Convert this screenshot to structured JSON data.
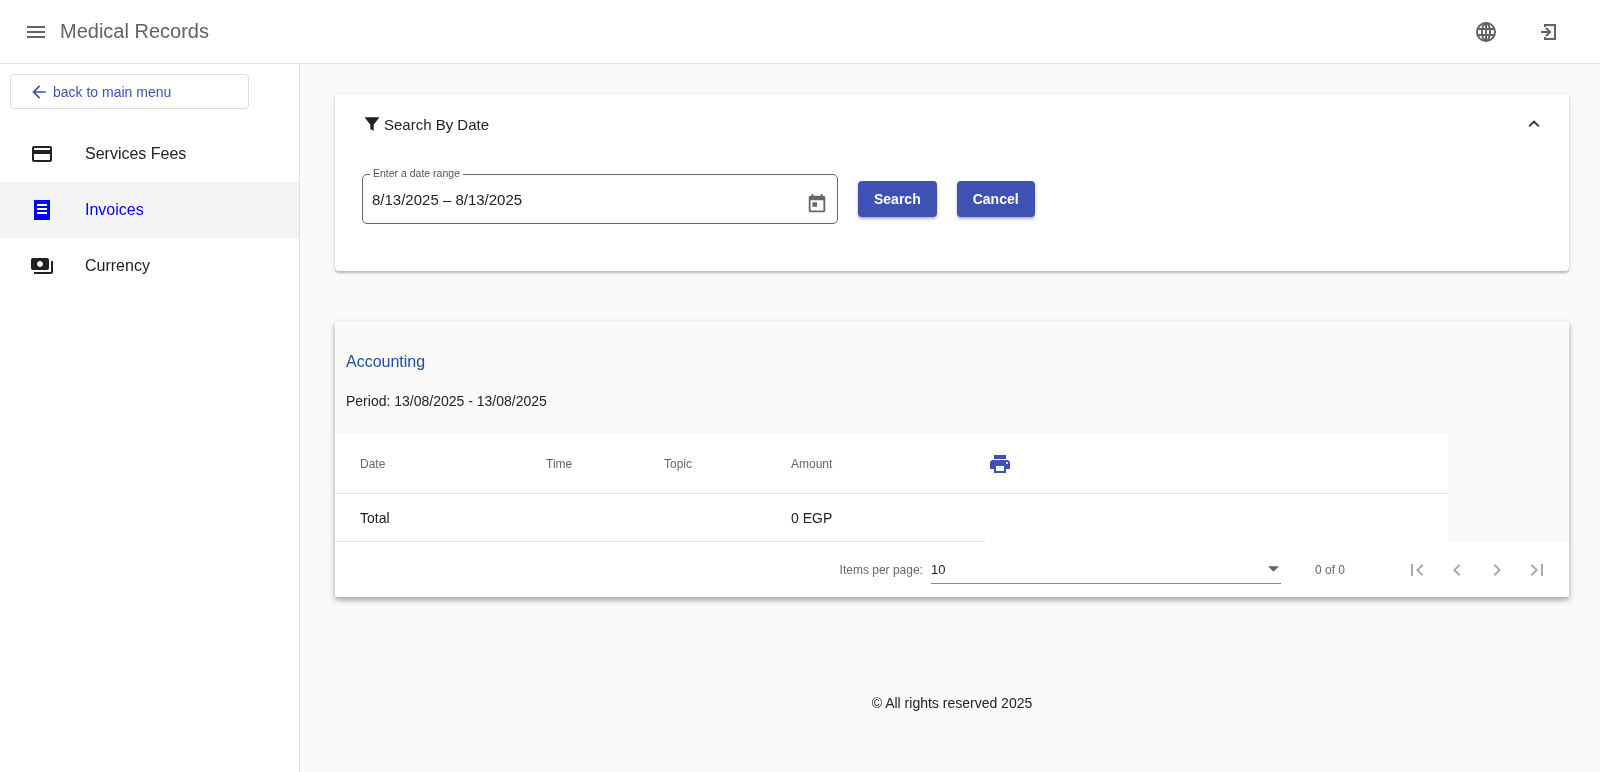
{
  "header": {
    "title": "Medical Records"
  },
  "sidebar": {
    "back_link": "back to main menu",
    "items": [
      {
        "label": "Services Fees",
        "selected": false
      },
      {
        "label": "Invoices",
        "selected": true
      },
      {
        "label": "Currency",
        "selected": false
      }
    ]
  },
  "search_panel": {
    "title": "Search By Date",
    "expanded": true,
    "date_field": {
      "label": "Enter a date range",
      "value": "8/13/2025 – 8/13/2025"
    },
    "buttons": [
      "Search",
      "Cancel"
    ]
  },
  "report": {
    "title": "Accounting",
    "period": "Period: 13/08/2025 - 13/08/2025",
    "table": {
      "columns": [
        "Date",
        "Time",
        "Topic",
        "Amount"
      ],
      "total_row": {
        "label": "Total",
        "amount": "0 EGP"
      }
    },
    "paginator": {
      "items_per_page_label": "Items per page:",
      "page_size": "10",
      "range": "0 of 0",
      "nav_buttons": [
        {
          "kind": "first",
          "disabled": true
        },
        {
          "kind": "previous",
          "disabled": true
        },
        {
          "kind": "next",
          "disabled": true
        },
        {
          "kind": "last",
          "disabled": true
        }
      ]
    }
  },
  "footer": {
    "text": "© All rights reserved 2025"
  }
}
